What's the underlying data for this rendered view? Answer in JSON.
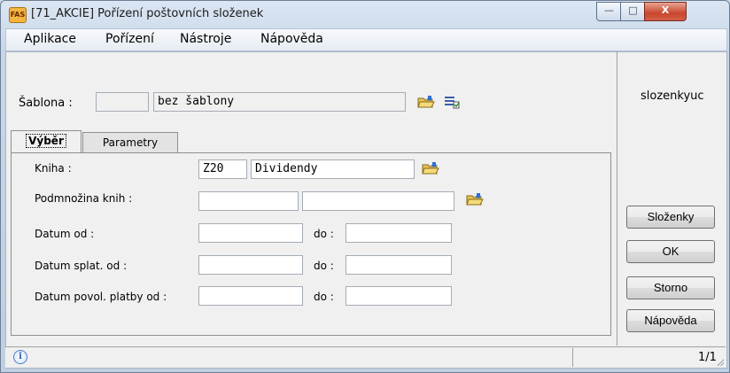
{
  "window": {
    "title": "[71_AKCIE] Pořízení poštovních složenek",
    "app_icon_text": "FAS",
    "minimize_glyph": "—",
    "maximize_glyph": "□",
    "close_glyph": "X"
  },
  "menu": [
    "Aplikace",
    "Pořízení",
    "Nástroje",
    "Nápověda"
  ],
  "template": {
    "label": "Šablona :",
    "code": "",
    "name": "bez šablony"
  },
  "user": "slozenkyuc",
  "tabs": [
    {
      "label": "Výběr",
      "active": true
    },
    {
      "label": "Parametry",
      "active": false
    }
  ],
  "form": {
    "kniha_label": "Kniha :",
    "kniha_code": "Z20",
    "kniha_name": "Dividendy",
    "podmnozina_label": "Podmnožina knih :",
    "podmnozina_a": "",
    "podmnozina_b": "",
    "datum_od_label": "Datum od :",
    "datum_splat_label": "Datum splat. od :",
    "datum_povol_label": "Datum povol. platby od :",
    "do_label": "do :"
  },
  "buttons": {
    "slozenky": "Složenky",
    "ok": "OK",
    "storno": "Storno",
    "napoveda": "Nápověda"
  },
  "status": {
    "page": "1/1"
  }
}
